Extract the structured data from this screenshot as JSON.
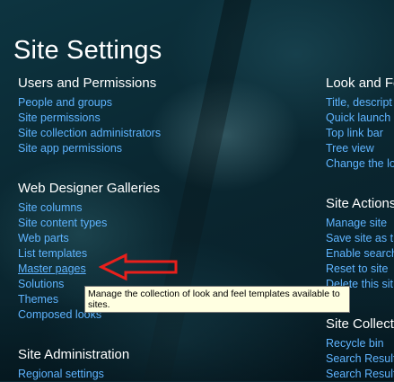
{
  "page_title": "Site Settings",
  "left_sections": [
    {
      "heading": "Users and Permissions",
      "links": [
        "People and groups",
        "Site permissions",
        "Site collection administrators",
        "Site app permissions"
      ]
    },
    {
      "heading": "Web Designer Galleries",
      "links": [
        "Site columns",
        "Site content types",
        "Web parts",
        "List templates",
        "Master pages",
        "Solutions",
        "Themes",
        "Composed looks"
      ]
    },
    {
      "heading": "Site Administration",
      "links": [
        "Regional settings"
      ]
    }
  ],
  "right_sections": [
    {
      "heading": "Look and Fe",
      "links": [
        "Title, descript",
        "Quick launch",
        "Top link bar",
        "Tree view",
        "Change the lo"
      ]
    },
    {
      "heading": "Site Actions",
      "links": [
        "Manage site",
        "Save site as t",
        "Enable search",
        "Reset to site",
        "Delete this sit"
      ]
    },
    {
      "heading": "Site Collecti",
      "links": [
        "Recycle bin",
        "Search Result",
        "Search Result"
      ]
    }
  ],
  "tooltip": "Manage the collection of look and feel templates available to sites.",
  "colors": {
    "link": "#5fb4ff",
    "heading": "#ffffff",
    "arrow": "#e8201c",
    "tooltip_bg": "#ffffe1"
  }
}
